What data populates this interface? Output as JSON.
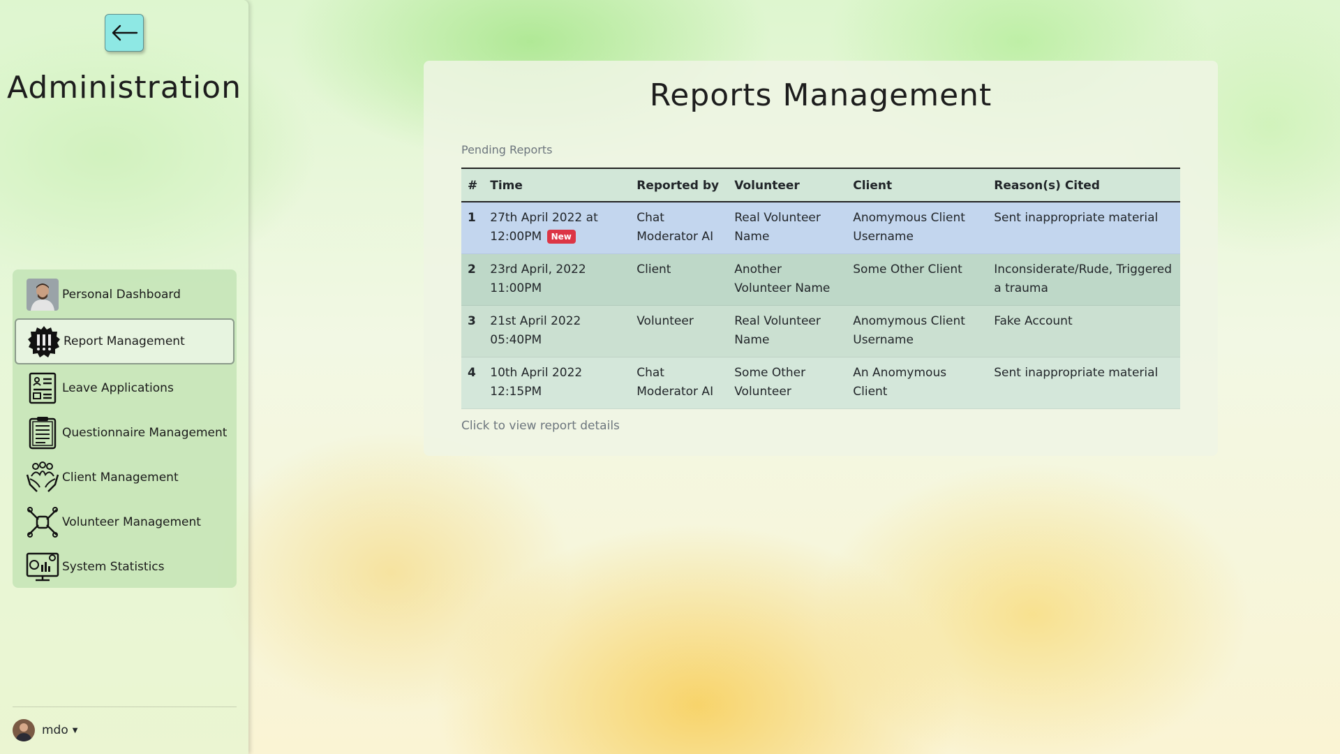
{
  "sidebar": {
    "title": "Administration",
    "nav": [
      {
        "label": "Personal Dashboard",
        "icon": "avatar-photo"
      },
      {
        "label": "Report Management",
        "icon": "report-badge-icon"
      },
      {
        "label": "Leave Applications",
        "icon": "form-document-icon"
      },
      {
        "label": "Questionnaire Management",
        "icon": "clipboard-icon"
      },
      {
        "label": "Client Management",
        "icon": "people-in-hands-icon"
      },
      {
        "label": "Volunteer Management",
        "icon": "hands-together-icon"
      },
      {
        "label": "System Statistics",
        "icon": "dashboard-monitor-icon"
      }
    ],
    "user": {
      "name": "mdo"
    }
  },
  "main": {
    "title": "Reports Management",
    "caption": "Pending Reports",
    "footer_caption": "Click to view report details",
    "table": {
      "headers": [
        "#",
        "Time",
        "Reported by",
        "Volunteer",
        "Client",
        "Reason(s) Cited"
      ],
      "rows": [
        {
          "num": "1",
          "time": "27th April 2022 at 12:00PM",
          "badge": "New",
          "reported_by": "Chat Moderator AI",
          "volunteer": "Real Volunteer Name",
          "client": "Anomymous Client Username",
          "reasons": "Sent inappropriate material"
        },
        {
          "num": "2",
          "time": "23rd April, 2022 11:00PM",
          "badge": "",
          "reported_by": "Client",
          "volunteer": "Another Volunteer Name",
          "client": "Some Other Client",
          "reasons": "Inconsiderate/Rude, Triggered a trauma"
        },
        {
          "num": "3",
          "time": "21st April 2022 05:40PM",
          "badge": "",
          "reported_by": "Volunteer",
          "volunteer": "Real Volunteer Name",
          "client": "Anomymous Client Username",
          "reasons": "Fake Account"
        },
        {
          "num": "4",
          "time": "10th April 2022 12:15PM",
          "badge": "",
          "reported_by": "Chat Moderator AI",
          "volunteer": "Some Other Volunteer",
          "client": "An Anomymous Client",
          "reasons": "Sent inappropriate material"
        }
      ]
    }
  },
  "colors": {
    "accent_button": "#8ee8e4",
    "selected_row": "#c3d6ee",
    "badge_new": "#dc3545"
  }
}
